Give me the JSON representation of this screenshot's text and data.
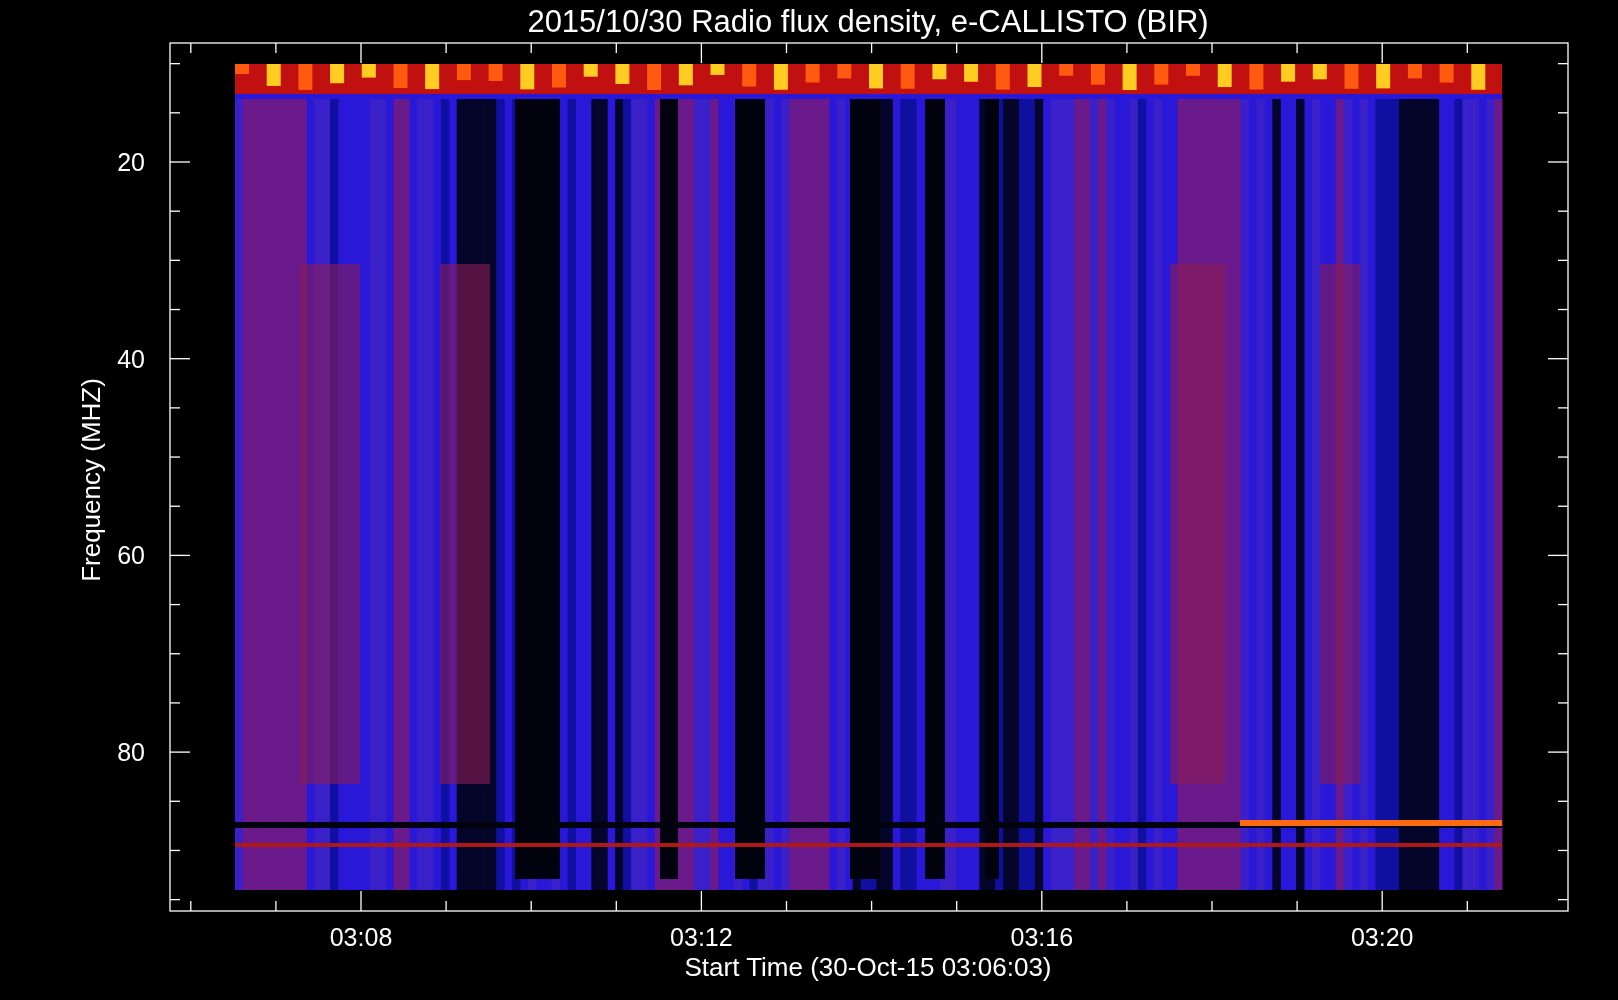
{
  "title": "2015/10/30  Radio flux density, e-CALLISTO (BIR)",
  "y_axis": {
    "label": "Frequency (MHZ)",
    "ticks": [
      "20",
      "40",
      "60",
      "80"
    ]
  },
  "x_axis": {
    "label": "Start Time (30-Oct-15 03:06:03)",
    "ticks": [
      "03:08",
      "03:12",
      "03:16",
      "03:20"
    ]
  }
}
